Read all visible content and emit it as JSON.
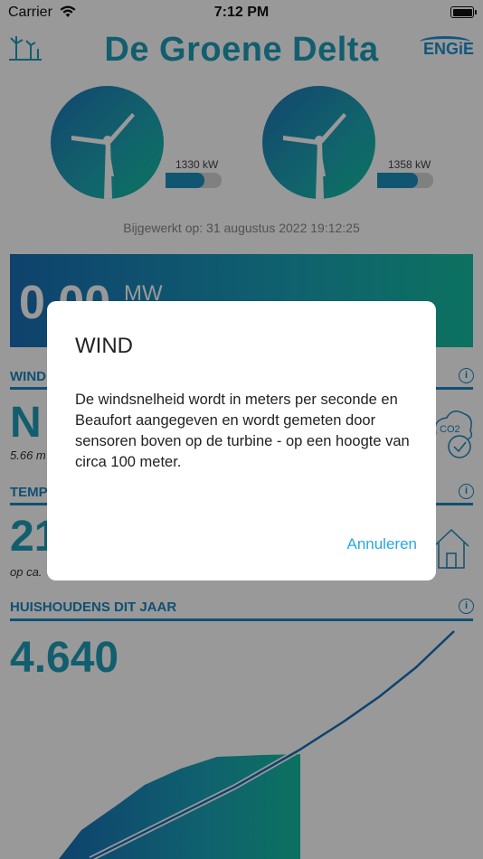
{
  "status_bar": {
    "carrier": "Carrier",
    "time": "7:12 PM"
  },
  "header": {
    "title": "De Groene Delta",
    "brand": "ENGiE"
  },
  "turbines": [
    {
      "power": "1330 kW",
      "level": 0.7
    },
    {
      "power": "1358 kW",
      "level": 0.72
    }
  ],
  "updated": "Bijgewerkt op: 31 augustus 2022 19:12:25",
  "power": {
    "value": "0.00",
    "unit": "MW"
  },
  "wind_section": {
    "title": "WIND",
    "value": "N",
    "sub": "5.66 m"
  },
  "temp_section": {
    "title": "TEMP",
    "value": "21",
    "sub": "op ca."
  },
  "households": {
    "title": "HUISHOUDENS DIT JAAR",
    "value": "4.640"
  },
  "dialog": {
    "title": "WIND",
    "message": "De windsnelheid wordt in meters per seconde en Beaufort aangegeven en wordt gemeten door sensoren boven op de turbine - op een hoogte van circa 100 meter.",
    "cancel_label": "Annuleren"
  },
  "colors": {
    "accent": "#1f9db8",
    "link": "#27a8e0",
    "line": "#1b86c0"
  }
}
